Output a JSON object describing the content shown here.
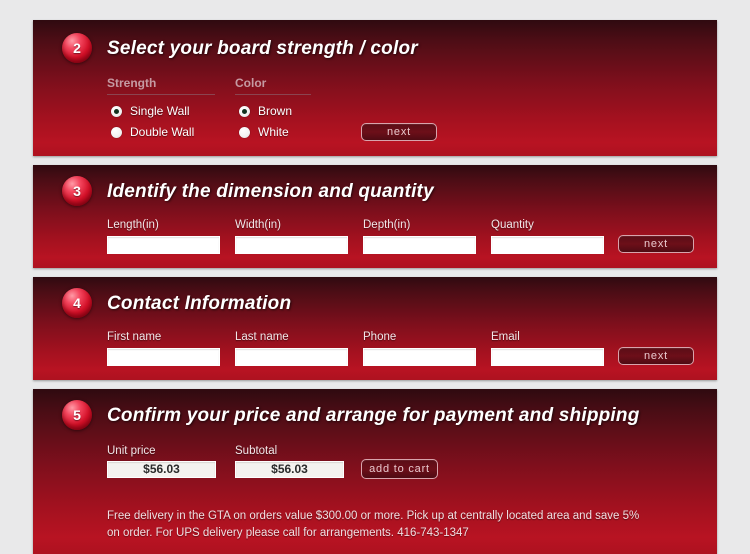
{
  "theme": {
    "page_background": "#e9e9ea",
    "panel_gradient_top": "#2f0a10",
    "panel_gradient_bottom": "#b81322",
    "badge_color": "#d31028",
    "heading_color": "#ffffff",
    "muted_label_color": "#c59aa2",
    "button_border_color": "#d8a4ac",
    "button_text_color": "#e8c9ce"
  },
  "sections": [
    {
      "number": "2",
      "title": "Select your board strength / color",
      "groups": [
        {
          "label": "Strength",
          "options": [
            {
              "label": "Single Wall",
              "checked": true
            },
            {
              "label": "Double Wall",
              "checked": false
            }
          ]
        },
        {
          "label": "Color",
          "options": [
            {
              "label": "Brown",
              "checked": true
            },
            {
              "label": "White",
              "checked": false
            }
          ]
        }
      ],
      "next_label": "next"
    },
    {
      "number": "3",
      "title": "Identify the dimension and quantity",
      "fields": [
        {
          "label": "Length(in)",
          "value": ""
        },
        {
          "label": "Width(in)",
          "value": ""
        },
        {
          "label": "Depth(in)",
          "value": ""
        },
        {
          "label": "Quantity",
          "value": ""
        }
      ],
      "next_label": "next"
    },
    {
      "number": "4",
      "title": "Contact Information",
      "fields": [
        {
          "label": "First name",
          "value": ""
        },
        {
          "label": "Last name",
          "value": ""
        },
        {
          "label": "Phone",
          "value": ""
        },
        {
          "label": "Email",
          "value": ""
        }
      ],
      "next_label": "next"
    },
    {
      "number": "5",
      "title": "Confirm your price and arrange for payment and shipping",
      "prices": [
        {
          "label": "Unit price",
          "value": "$56.03"
        },
        {
          "label": "Subtotal",
          "value": "$56.03"
        }
      ],
      "cart_label": "add to cart",
      "note": "Free delivery in the GTA on orders value $300.00 or more. Pick up at centrally located area and save 5% on order. For UPS delivery please call for arrangements. 416-743-1347"
    }
  ]
}
